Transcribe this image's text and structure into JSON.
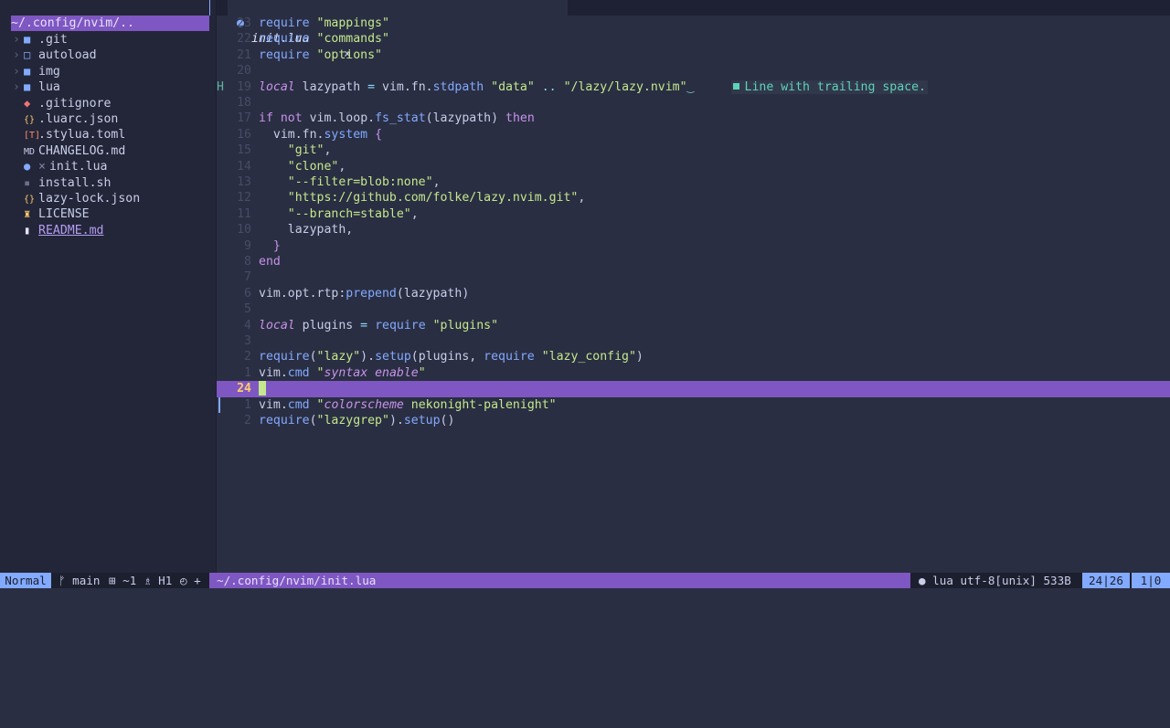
{
  "tree": {
    "header": "~/.config/nvim/..",
    "items": [
      {
        "chev": "›",
        "icon": "■",
        "label": "",
        "name": ".git",
        "icolor": "#82aaff"
      },
      {
        "chev": "›",
        "icon": "□",
        "label": "",
        "name": "autoload",
        "icolor": "#82aaff"
      },
      {
        "chev": "›",
        "icon": "■",
        "label": "",
        "name": "img",
        "icolor": "#82aaff"
      },
      {
        "chev": "›",
        "icon": "■",
        "label": "",
        "name": "lua",
        "icolor": "#82aaff"
      },
      {
        "chev": "",
        "icon": "◆",
        "label": "",
        "name": ".gitignore",
        "icolor": "#f07178"
      },
      {
        "chev": "",
        "icon": "{}",
        "label": "",
        "name": ".luarc.json",
        "icolor": "#ffcb6b"
      },
      {
        "chev": "",
        "icon": "[T]",
        "label": "",
        "name": ".stylua.toml",
        "icolor": "#f78c6c"
      },
      {
        "chev": "",
        "icon": "MD",
        "label": "",
        "name": "CHANGELOG.md",
        "icolor": "#c8cde8"
      },
      {
        "chev": "",
        "icon": "●",
        "label": "×",
        "name": "init.lua",
        "icolor": "#82aaff"
      },
      {
        "chev": "",
        "icon": "▪",
        "label": "",
        "name": "install.sh",
        "icolor": "#6b7089"
      },
      {
        "chev": "",
        "icon": "{}",
        "label": "",
        "name": "lazy-lock.json",
        "icolor": "#ffcb6b"
      },
      {
        "chev": "",
        "icon": "♜",
        "label": "",
        "name": "LICENSE",
        "icolor": "#ffcb6b"
      },
      {
        "chev": "",
        "icon": "▮",
        "label": "",
        "name": "README.md",
        "icolor": "#e8e0ff"
      }
    ]
  },
  "tab": {
    "icon": "●",
    "name": "init.lua",
    "close": "×"
  },
  "editor": {
    "current_line": "24",
    "git_sign": "H",
    "diagnostic": "Line with trailing space.",
    "lines": [
      [
        [
          "fn",
          "require"
        ],
        [
          "pn",
          " "
        ],
        [
          "st",
          "\"mappings\""
        ]
      ],
      [
        [
          "fn",
          "require"
        ],
        [
          "pn",
          " "
        ],
        [
          "st",
          "\"commands\""
        ]
      ],
      [
        [
          "fn",
          "require"
        ],
        [
          "pn",
          " "
        ],
        [
          "st",
          "\"options\""
        ]
      ],
      [],
      [
        [
          "kwi",
          "local"
        ],
        [
          "id",
          " lazypath "
        ],
        [
          "op",
          "="
        ],
        [
          "id",
          " vim.fn."
        ],
        [
          "fn",
          "stdpath"
        ],
        [
          "pn",
          " "
        ],
        [
          "st",
          "\"data\""
        ],
        [
          "pn",
          " "
        ],
        [
          "op",
          ".."
        ],
        [
          "pn",
          " "
        ],
        [
          "st",
          "\"/lazy/lazy.nvim\""
        ],
        [
          "trail",
          "‿"
        ]
      ],
      [],
      [
        [
          "kw",
          "if"
        ],
        [
          "pn",
          " "
        ],
        [
          "kw",
          "not"
        ],
        [
          "id",
          " vim.loop."
        ],
        [
          "fn",
          "fs_stat"
        ],
        [
          "pn",
          "(lazypath) "
        ],
        [
          "kw",
          "then"
        ]
      ],
      [
        [
          "pn",
          "  vim.fn."
        ],
        [
          "fn",
          "system"
        ],
        [
          "pn",
          " "
        ],
        [
          "br",
          "{"
        ]
      ],
      [
        [
          "pn",
          "    "
        ],
        [
          "st",
          "\"git\""
        ],
        [
          "pn",
          ","
        ]
      ],
      [
        [
          "pn",
          "    "
        ],
        [
          "st",
          "\"clone\""
        ],
        [
          "pn",
          ","
        ]
      ],
      [
        [
          "pn",
          "    "
        ],
        [
          "st",
          "\"--filter=blob:none\""
        ],
        [
          "pn",
          ","
        ]
      ],
      [
        [
          "pn",
          "    "
        ],
        [
          "st",
          "\"https://github.com/folke/lazy.nvim.git\""
        ],
        [
          "pn",
          ","
        ]
      ],
      [
        [
          "pn",
          "    "
        ],
        [
          "st",
          "\"--branch=stable\""
        ],
        [
          "pn",
          ","
        ]
      ],
      [
        [
          "pn",
          "    lazypath,"
        ]
      ],
      [
        [
          "pn",
          "  "
        ],
        [
          "br",
          "}"
        ]
      ],
      [
        [
          "kw",
          "end"
        ]
      ],
      [],
      [
        [
          "id",
          "vim.opt.rtp:"
        ],
        [
          "fn",
          "prepend"
        ],
        [
          "pn",
          "(lazypath)"
        ]
      ],
      [],
      [
        [
          "kwi",
          "local"
        ],
        [
          "id",
          " plugins "
        ],
        [
          "op",
          "="
        ],
        [
          "pn",
          " "
        ],
        [
          "fn",
          "require"
        ],
        [
          "pn",
          " "
        ],
        [
          "st",
          "\"plugins\""
        ]
      ],
      [],
      [
        [
          "fn",
          "require"
        ],
        [
          "pn",
          "("
        ],
        [
          "st",
          "\"lazy\""
        ],
        [
          "pn",
          ")."
        ],
        [
          "fn",
          "setup"
        ],
        [
          "pn",
          "(plugins, "
        ],
        [
          "fn",
          "require"
        ],
        [
          "pn",
          " "
        ],
        [
          "st",
          "\"lazy_config\""
        ],
        [
          "pn",
          ")"
        ]
      ],
      [
        [
          "id",
          "vim."
        ],
        [
          "fn",
          "cmd"
        ],
        [
          "pn",
          " "
        ],
        [
          "st",
          "\""
        ],
        [
          "it",
          "syntax enable"
        ],
        [
          "st",
          "\""
        ]
      ],
      [],
      [
        [
          "id",
          "vim."
        ],
        [
          "fn",
          "cmd"
        ],
        [
          "pn",
          " "
        ],
        [
          "st",
          "\""
        ],
        [
          "it",
          "colorscheme"
        ],
        [
          "st",
          " nekonight-palenight\""
        ]
      ],
      [
        [
          "fn",
          "require"
        ],
        [
          "pn",
          "("
        ],
        [
          "st",
          "\"lazygrep\""
        ],
        [
          "pn",
          ")."
        ],
        [
          "fn",
          "setup"
        ],
        [
          "pn",
          "()"
        ]
      ]
    ]
  },
  "status": {
    "mode": "Normal",
    "branch": "ᚠ main",
    "diff": "⊞ ~1",
    "hint": "♗ H1",
    "extra": "◴ +",
    "path": "~/.config/nvim/init.lua",
    "filetype": "● lua utf-8[unix] 533B",
    "position": "24|26",
    "column": "1|0"
  }
}
